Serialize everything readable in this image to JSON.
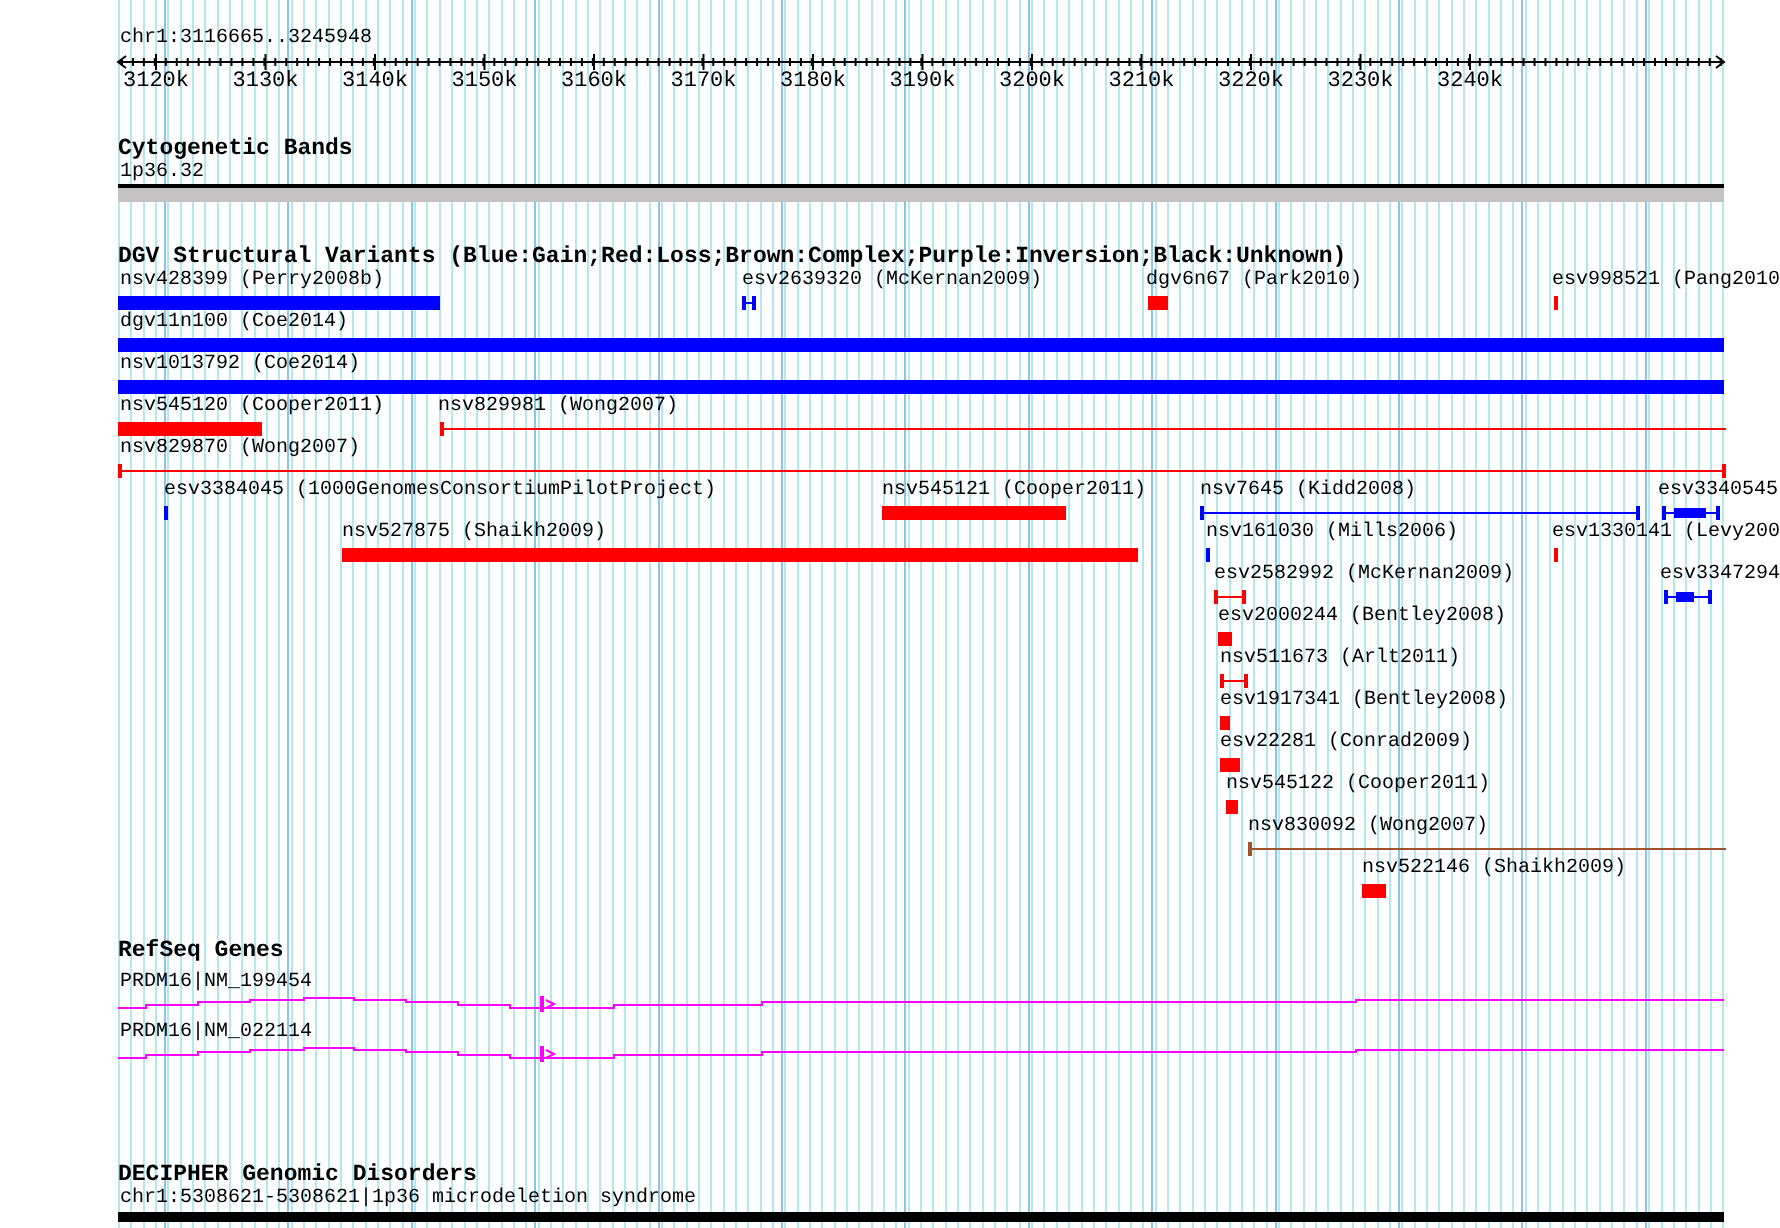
{
  "header": {
    "range": "chr1:3116665..3245948",
    "ticks": [
      "3120k",
      "3130k",
      "3140k",
      "3150k",
      "3160k",
      "3170k",
      "3180k",
      "3190k",
      "3200k",
      "3210k",
      "3220k",
      "3230k",
      "3240k"
    ]
  },
  "tracks": [
    {
      "kind": "bands",
      "title": "Cytogenetic Bands",
      "features": [
        {
          "label": "1p36.32"
        }
      ]
    },
    {
      "kind": "variants",
      "title": "DGV Structural Variants (Blue:Gain;Red:Loss;Brown:Complex;Purple:Inversion;Black:Unknown)",
      "features": [
        {
          "label": "nsv428399 (Perry2008b)",
          "kind": "bar",
          "color": "#0000ff"
        },
        {
          "label": "esv2639320 (McKernan2009)",
          "kind": "line",
          "color": "#0000ff"
        },
        {
          "label": "dgv6n67 (Park2010)",
          "kind": "bar",
          "color": "#ff0000"
        },
        {
          "label": "esv998521 (Pang2010",
          "kind": "bar",
          "color": "#ff0000"
        },
        {
          "label": "dgv11n100 (Coe2014)",
          "kind": "bar",
          "color": "#0000ff"
        },
        {
          "label": "nsv1013792 (Coe2014)",
          "kind": "bar",
          "color": "#0000ff"
        },
        {
          "label": "nsv545120 (Cooper2011)",
          "kind": "bar",
          "color": "#ff0000"
        },
        {
          "label": "nsv829981 (Wong2007)",
          "kind": "line",
          "color": "#ff0000"
        },
        {
          "label": "nsv829870 (Wong2007)",
          "kind": "line",
          "color": "#ff0000"
        },
        {
          "label": "esv3384045 (1000GenomesConsortiumPilotProject)",
          "kind": "bar",
          "color": "#0000ff"
        },
        {
          "label": "nsv545121 (Cooper2011)",
          "kind": "bar",
          "color": "#ff0000"
        },
        {
          "label": "nsv7645 (Kidd2008)",
          "kind": "line",
          "color": "#0000ff"
        },
        {
          "label": "esv3340545",
          "kind": "line",
          "color": "#0000ff"
        },
        {
          "label": "nsv527875 (Shaikh2009)",
          "kind": "bar",
          "color": "#ff0000"
        },
        {
          "label": "nsv161030 (Mills2006)",
          "kind": "bar",
          "color": "#0000ff"
        },
        {
          "label": "esv1330141 (Levy200",
          "kind": "bar",
          "color": "#ff0000"
        },
        {
          "label": "esv2582992 (McKernan2009)",
          "kind": "line",
          "color": "#ff0000"
        },
        {
          "label": "esv3347294",
          "kind": "line",
          "color": "#0000ff"
        },
        {
          "label": "esv2000244 (Bentley2008)",
          "kind": "bar",
          "color": "#ff0000"
        },
        {
          "label": "nsv511673 (Arlt2011)",
          "kind": "line",
          "color": "#ff0000"
        },
        {
          "label": "esv1917341 (Bentley2008)",
          "kind": "bar",
          "color": "#ff0000"
        },
        {
          "label": "esv22281 (Conrad2009)",
          "kind": "bar",
          "color": "#ff0000"
        },
        {
          "label": "nsv545122 (Cooper2011)",
          "kind": "bar",
          "color": "#ff0000"
        },
        {
          "label": "nsv830092 (Wong2007)",
          "kind": "line",
          "color": "#a0522d"
        },
        {
          "label": "nsv522146 (Shaikh2009)",
          "kind": "bar",
          "color": "#ff0000"
        }
      ]
    },
    {
      "kind": "genes",
      "title": "RefSeq Genes",
      "features": [
        {
          "label": "PRDM16|NM_199454"
        },
        {
          "label": "PRDM16|NM_022114"
        }
      ]
    },
    {
      "kind": "disorders",
      "title": "DECIPHER Genomic Disorders",
      "features": [
        {
          "label": "chr1:5308621-5308621|1p36 microdeletion syndrome"
        }
      ]
    }
  ]
}
